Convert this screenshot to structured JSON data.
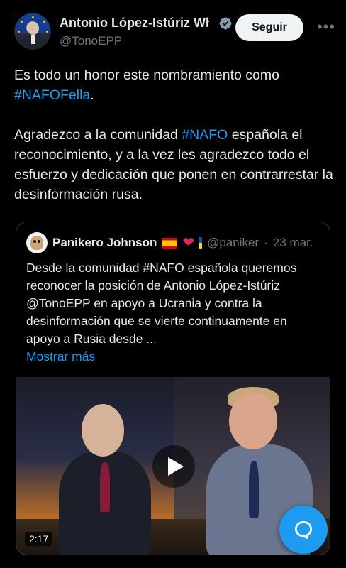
{
  "author": {
    "display_name": "Antonio López-Istúriz Wł",
    "handle": "@TonoEPP",
    "verified": true
  },
  "actions": {
    "follow_label": "Seguir",
    "more_label": "•••"
  },
  "tweet": {
    "para1_text": "Es todo un honor este nombramiento como ",
    "para1_hashtag": "#NAFOFella",
    "para1_end": ".",
    "para2_start": "Agradezco a la comunidad ",
    "para2_hashtag": "#NAFO",
    "para2_rest": " española el reconocimiento, y a la vez les agradezco todo el esfuerzo y dedicación que ponen en contrarrestar la desinformación rusa."
  },
  "quote": {
    "name": "Panikero Johnson",
    "handle": "@paniker",
    "separator": "·",
    "date": "23 mar.",
    "text": "Desde la comunidad #NAFO española queremos reconocer la posición de Antonio López-Istúriz @TonoEPP en apoyo a Ucrania y contra la desinformación que se vierte continuamente en apoyo a Rusia desde ...",
    "show_more": "Mostrar más",
    "video_duration": "2:17"
  },
  "colors": {
    "accent": "#1d9bf0",
    "background": "#000000",
    "text": "#e7e9ea",
    "muted": "#71767b"
  }
}
